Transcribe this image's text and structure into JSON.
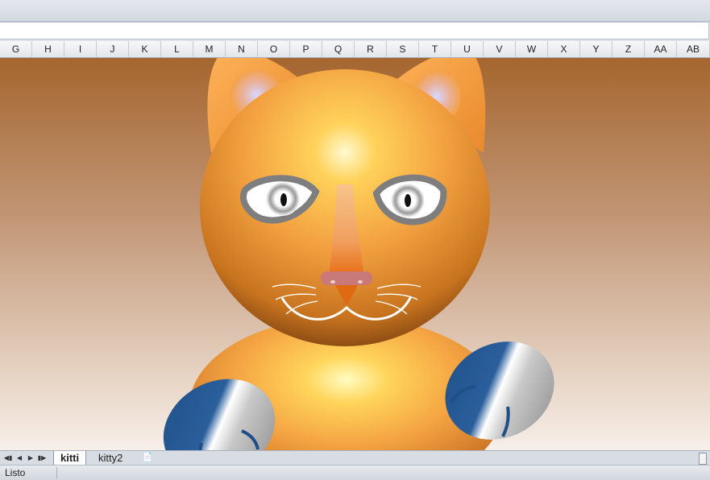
{
  "window": {
    "formula_value": ""
  },
  "columns": [
    "G",
    "H",
    "I",
    "J",
    "K",
    "L",
    "M",
    "N",
    "O",
    "P",
    "Q",
    "R",
    "S",
    "T",
    "U",
    "V",
    "W",
    "X",
    "Y",
    "Z",
    "AA",
    "AB"
  ],
  "sheet_tabs": {
    "active": "kitti",
    "second": "kitty2"
  },
  "statusbar": {
    "ready": "Listo"
  },
  "colors": {
    "fur": "#f3a040",
    "paw": "#1f4f86",
    "eye_rim": "#808080",
    "nose": "#c97a78"
  },
  "icons": [
    "first-sheet-icon",
    "prev-sheet-icon",
    "next-sheet-icon",
    "last-sheet-icon",
    "insert-sheet-icon"
  ]
}
